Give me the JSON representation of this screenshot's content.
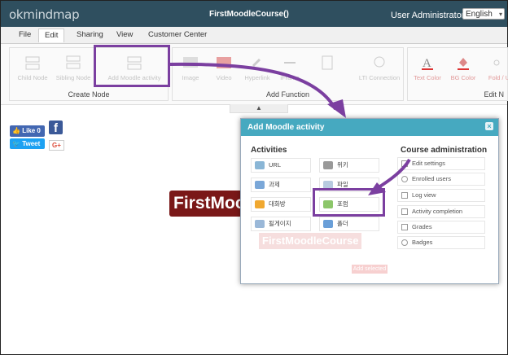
{
  "app": {
    "logo": "okmindmap",
    "document_title": "FirstMoodleCourse()",
    "user": "User Administrator",
    "language": "English"
  },
  "menu": [
    "File",
    "Edit",
    "Sharing",
    "View",
    "Customer Center"
  ],
  "ribbon": {
    "groups": [
      {
        "label": "Create Node",
        "buttons": [
          "Child Node",
          "Sibling Node",
          "Add Moodle activity"
        ]
      },
      {
        "label": "Add Function",
        "buttons": [
          "Image",
          "Video",
          "Hyperlink",
          "iFrame",
          "",
          "",
          "LTI Connection"
        ]
      },
      {
        "label": "Edit N",
        "buttons": [
          "Text Color",
          "BG Color",
          "Fold / U"
        ]
      }
    ]
  },
  "social": {
    "like": "Like 0",
    "tweet": "Tweet",
    "gplus": "G+"
  },
  "central_node": "FirstMoodleCourse",
  "dialog": {
    "title": "Add Moodle activity",
    "activities_title": "Activities",
    "activities": [
      "URL",
      "위키",
      "과제",
      "파일",
      "대화방",
      "포럼",
      "될게이지",
      "폴더"
    ],
    "admin_title": "Course administration",
    "admin_items": [
      "Edit settings",
      "Enrolled users",
      "Log view",
      "Activity completion",
      "Grades",
      "Badges"
    ],
    "ghost_title": "FirstMoodleCourse",
    "add_selected": "Add selected"
  },
  "colors": {
    "titlebar": "#2f4f5f",
    "dialog_header": "#46a9c0",
    "highlight": "#7b3fa0",
    "central_node": "#7a1818"
  }
}
